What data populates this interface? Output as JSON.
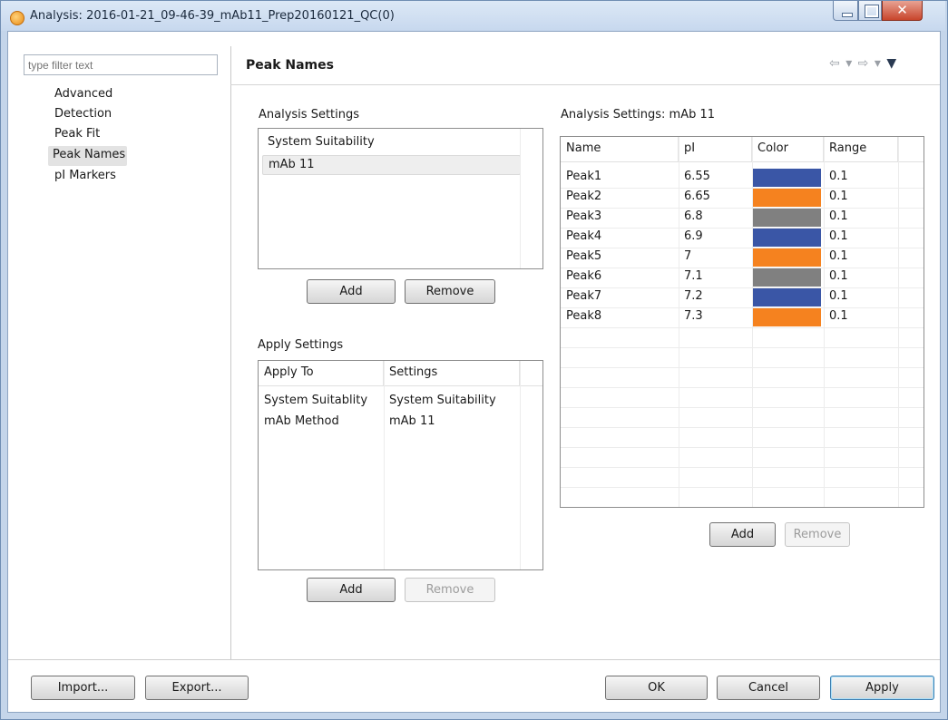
{
  "window": {
    "title": "Analysis: 2016-01-21_09-46-39_mAb11_Prep20160121_QC(0)",
    "close_glyph": "✕"
  },
  "filter": {
    "placeholder": "type filter text"
  },
  "tree": {
    "items": [
      {
        "label": "Advanced"
      },
      {
        "label": "Detection"
      },
      {
        "label": "Peak Fit"
      },
      {
        "label": "Peak Names",
        "selected": true
      },
      {
        "label": "pI Markers"
      }
    ]
  },
  "page": {
    "title": "Peak Names",
    "nav_back": "⇦",
    "nav_fwd": "⇨",
    "nav_dd": "▾",
    "nav_menu": "▼"
  },
  "analysis_settings": {
    "label": "Analysis Settings",
    "items": [
      "System Suitability",
      "mAb 11"
    ],
    "selected_index": 1,
    "add_label": "Add",
    "remove_label": "Remove"
  },
  "apply_settings": {
    "label": "Apply Settings",
    "columns": [
      "Apply To",
      "Settings"
    ],
    "rows": [
      [
        "System Suitablity",
        "System Suitability"
      ],
      [
        "mAb Method",
        "mAb 11"
      ]
    ],
    "add_label": "Add",
    "remove_label": "Remove"
  },
  "peaks": {
    "label": "Analysis Settings: mAb 11",
    "columns": [
      "Name",
      "pI",
      "Color",
      "Range"
    ],
    "rows": [
      {
        "name": "Peak1",
        "pi": "6.55",
        "color": "#3a56a6",
        "range": "0.1"
      },
      {
        "name": "Peak2",
        "pi": "6.65",
        "color": "#f5821f",
        "range": "0.1"
      },
      {
        "name": "Peak3",
        "pi": "6.8",
        "color": "#808080",
        "range": "0.1"
      },
      {
        "name": "Peak4",
        "pi": "6.9",
        "color": "#3a56a6",
        "range": "0.1"
      },
      {
        "name": "Peak5",
        "pi": "7",
        "color": "#f5821f",
        "range": "0.1"
      },
      {
        "name": "Peak6",
        "pi": "7.1",
        "color": "#808080",
        "range": "0.1"
      },
      {
        "name": "Peak7",
        "pi": "7.2",
        "color": "#3a56a6",
        "range": "0.1"
      },
      {
        "name": "Peak8",
        "pi": "7.3",
        "color": "#f5821f",
        "range": "0.1"
      }
    ],
    "add_label": "Add",
    "remove_label": "Remove"
  },
  "footer": {
    "import_label": "Import...",
    "export_label": "Export...",
    "ok_label": "OK",
    "cancel_label": "Cancel",
    "apply_label": "Apply"
  }
}
